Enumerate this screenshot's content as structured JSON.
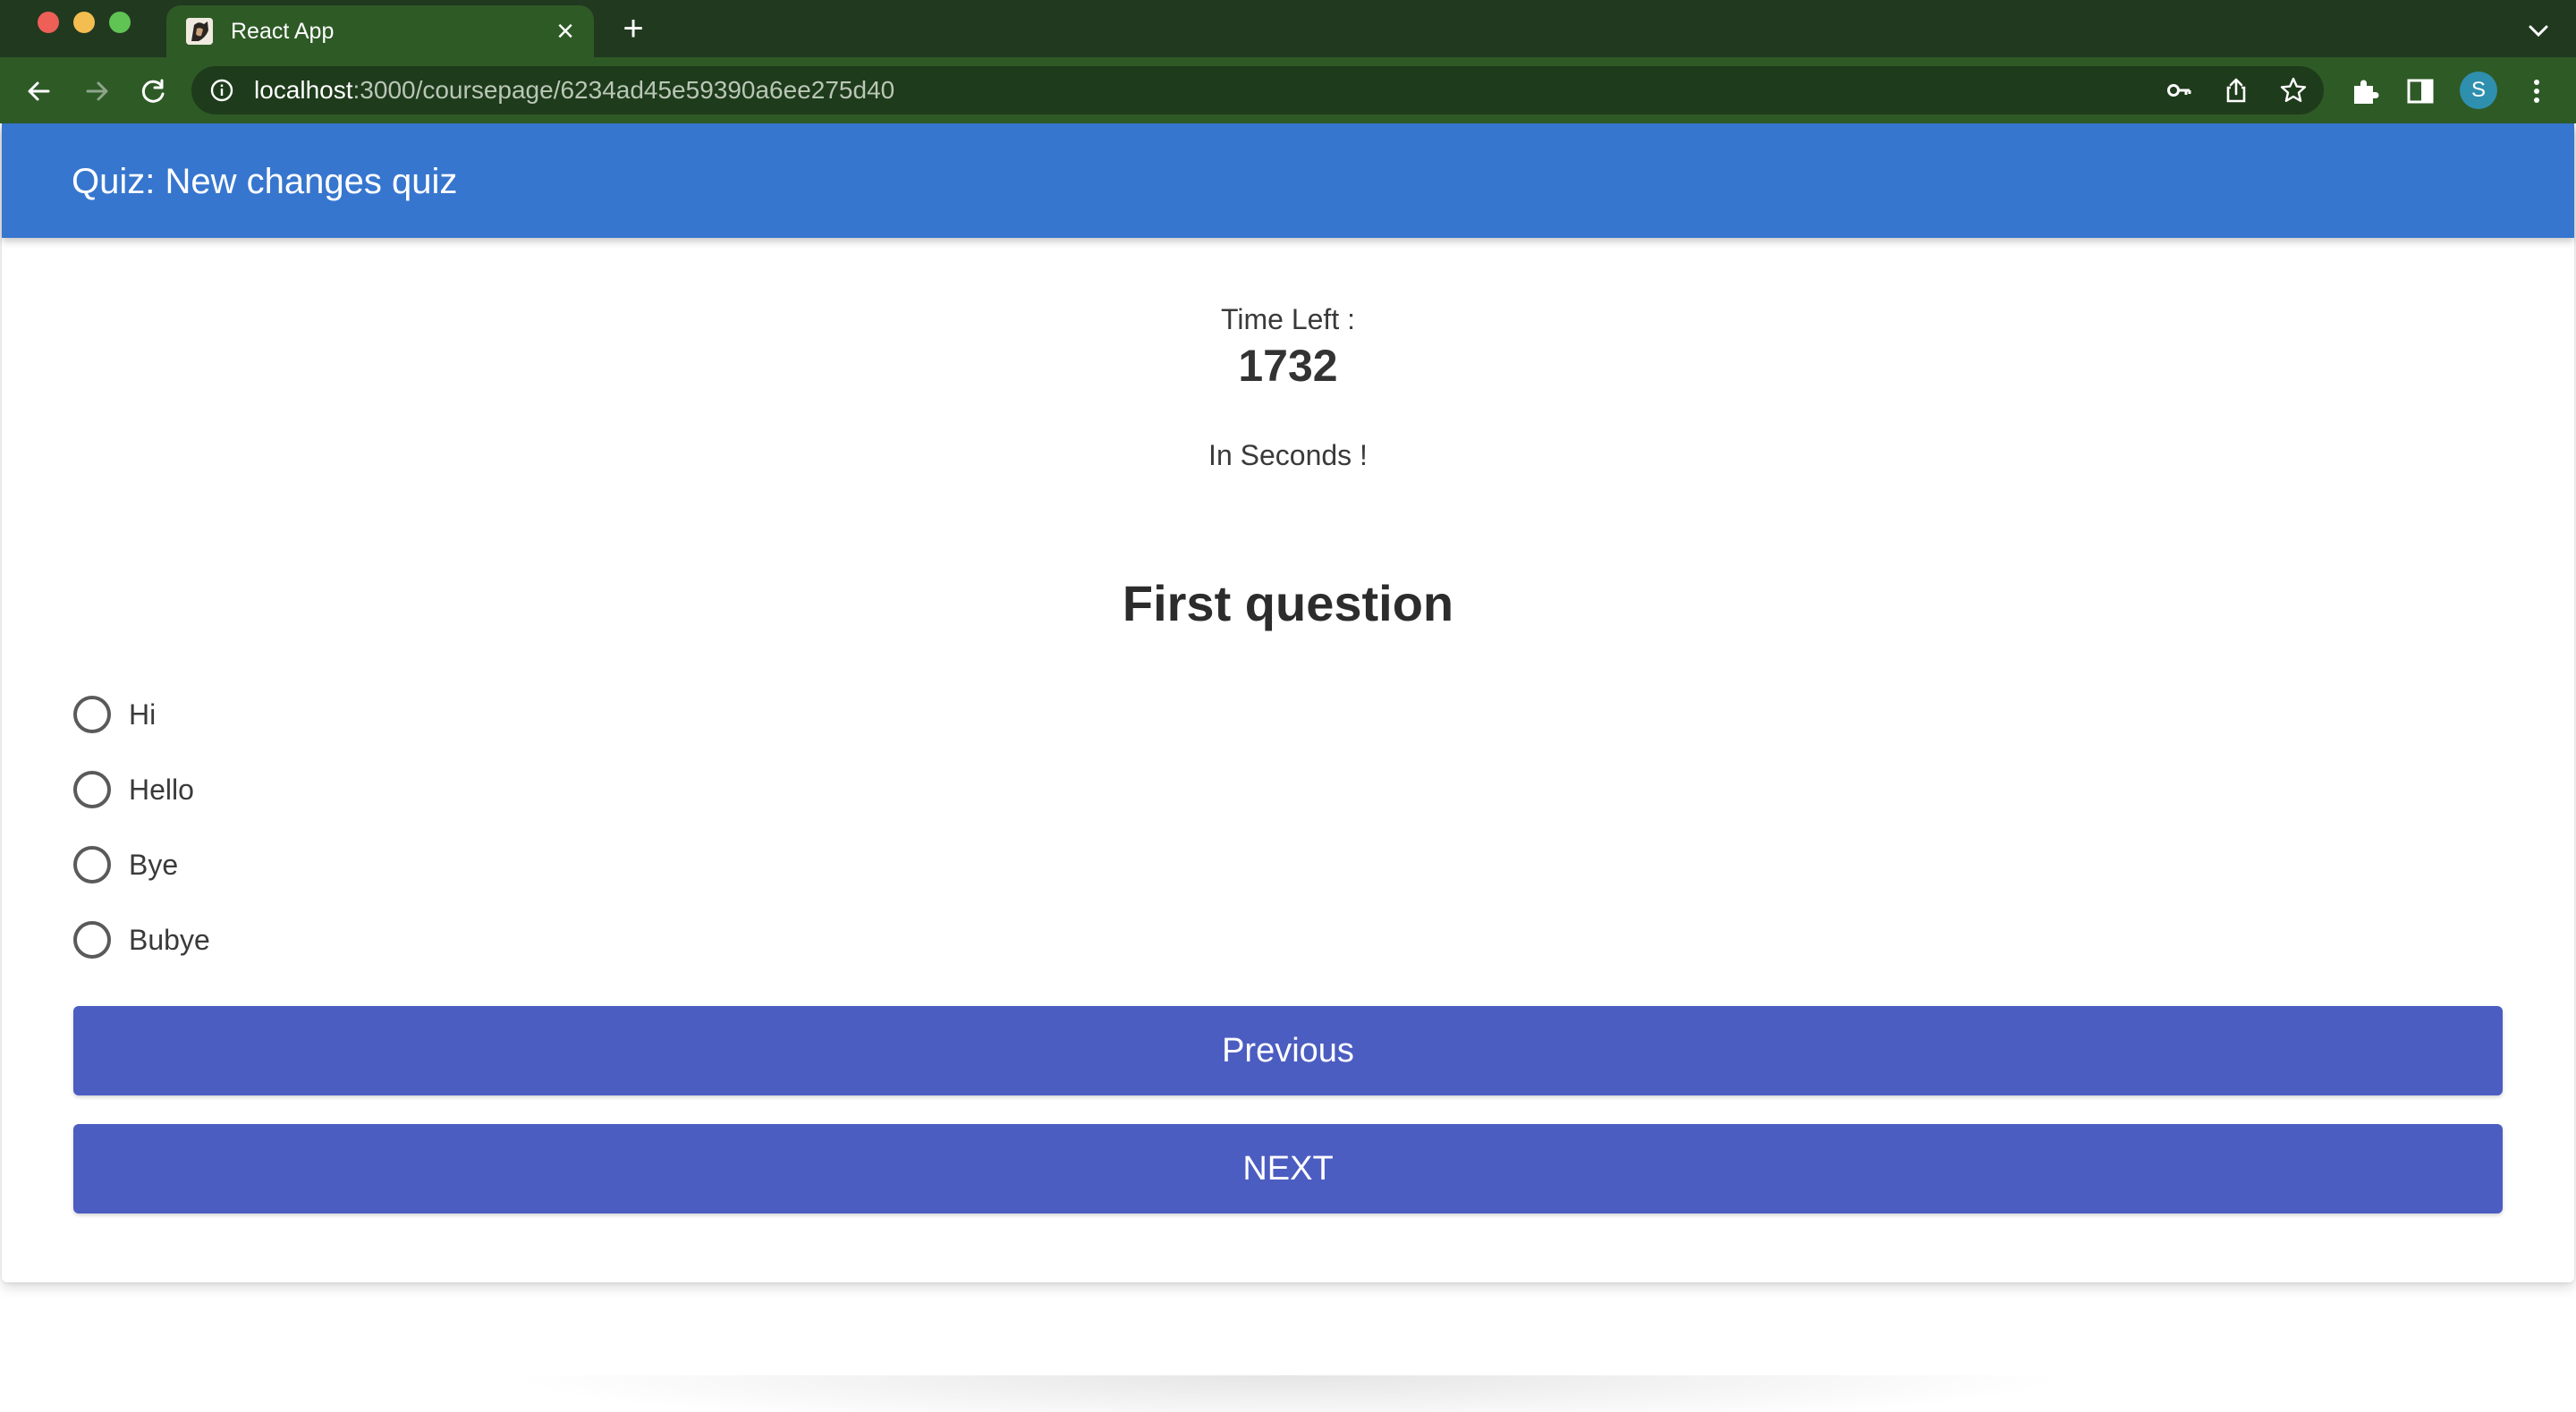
{
  "browser": {
    "tab_title": "React App",
    "url_host": "localhost",
    "url_path": ":3000/coursepage/6234ad45e59390a6ee275d40",
    "profile_initial": "S",
    "colors": {
      "frame": "#21391f",
      "toolbar": "#2e5a26",
      "omnibox": "#1e3b1b"
    }
  },
  "app": {
    "title": "Quiz: New changes quiz",
    "colors": {
      "appbar": "#3776cf",
      "button": "#4c5dc1"
    }
  },
  "timer": {
    "label": "Time Left :",
    "value": "1732",
    "unit_text": "In Seconds !"
  },
  "question": {
    "text": "First question",
    "options": [
      {
        "label": "Hi",
        "selected": false
      },
      {
        "label": "Hello",
        "selected": false
      },
      {
        "label": "Bye",
        "selected": false
      },
      {
        "label": "Bubye",
        "selected": false
      }
    ]
  },
  "buttons": {
    "previous": "Previous",
    "next": "NEXT"
  }
}
